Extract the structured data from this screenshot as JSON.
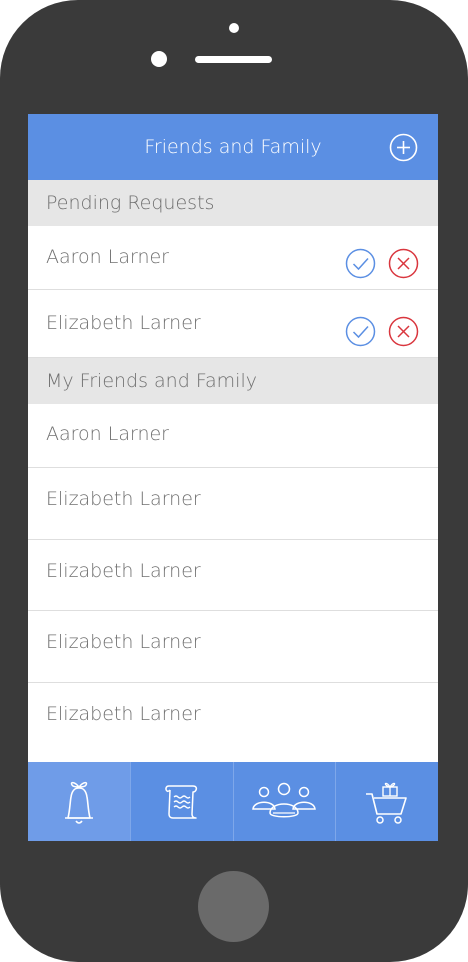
{
  "header": {
    "title": "Friends and Family",
    "add_icon": "plus-circle-icon"
  },
  "pending": {
    "title": "Pending Requests",
    "requests": [
      {
        "name": "Aaron Larner"
      },
      {
        "name": "Elizabeth Larner"
      }
    ],
    "accept_icon": "check-circle-icon",
    "decline_icon": "x-circle-icon"
  },
  "friends": {
    "title": "My Friends and Family",
    "items": [
      {
        "name": "Aaron Larner"
      },
      {
        "name": "Elizabeth Larner"
      },
      {
        "name": "Elizabeth Larner"
      },
      {
        "name": "Elizabeth Larner"
      },
      {
        "name": "Elizabeth Larner"
      }
    ]
  },
  "tabs": [
    {
      "icon": "bell-icon",
      "active": true
    },
    {
      "icon": "scroll-icon",
      "active": false
    },
    {
      "icon": "people-group-icon",
      "active": false
    },
    {
      "icon": "shopping-cart-gift-icon",
      "active": false
    }
  ],
  "colors": {
    "accent": "#5b8fe3",
    "accept": "#5b8fe3",
    "decline": "#d9363e",
    "section_bg": "#e6e6e6",
    "device": "#3a3a3a"
  }
}
